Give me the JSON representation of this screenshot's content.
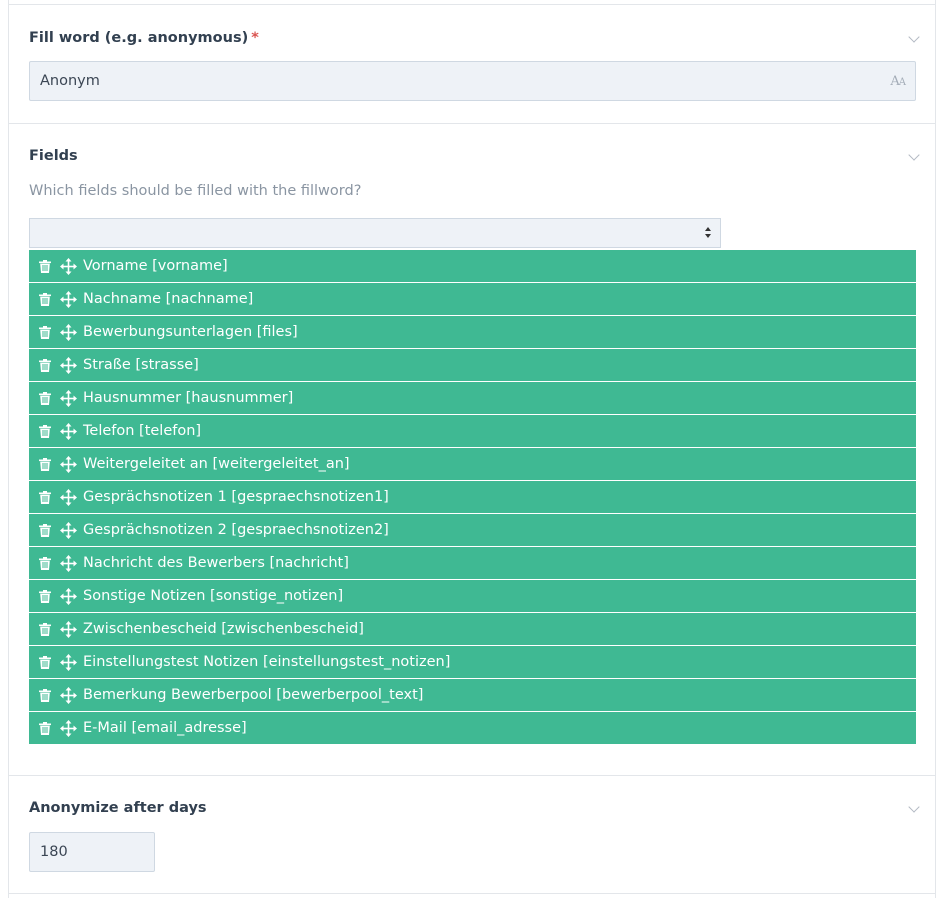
{
  "fill_word": {
    "label": "Fill word (e.g. anonymous)",
    "required_mark": "*",
    "value": "Anonym",
    "type_icon": "text-format-icon",
    "type_icon_text": "AA"
  },
  "fields": {
    "label": "Fields",
    "help": "Which fields should be filled with the fillword?",
    "select_value": "",
    "items": [
      {
        "label": "Vorname [vorname]"
      },
      {
        "label": "Nachname [nachname]"
      },
      {
        "label": "Bewerbungsunterlagen [files]"
      },
      {
        "label": "Straße [strasse]"
      },
      {
        "label": "Hausnummer [hausnummer]"
      },
      {
        "label": "Telefon [telefon]"
      },
      {
        "label": "Weitergeleitet an [weitergeleitet_an]"
      },
      {
        "label": "Gesprächsnotizen 1 [gespraechsnotizen1]"
      },
      {
        "label": "Gesprächsnotizen 2 [gespraechsnotizen2]"
      },
      {
        "label": "Nachricht des Bewerbers [nachricht]"
      },
      {
        "label": "Sonstige Notizen [sonstige_notizen]"
      },
      {
        "label": "Zwischenbescheid [zwischenbescheid]"
      },
      {
        "label": "Einstellungstest Notizen [einstellungstest_notizen]"
      },
      {
        "label": "Bemerkung Bewerberpool [bewerberpool_text]"
      },
      {
        "label": "E-Mail [email_adresse]"
      }
    ]
  },
  "anonymize_days": {
    "label": "Anonymize after days",
    "value": "180"
  },
  "colors": {
    "item_bg": "#3fb993",
    "input_bg": "#eef2f7",
    "required": "#d9534f"
  }
}
